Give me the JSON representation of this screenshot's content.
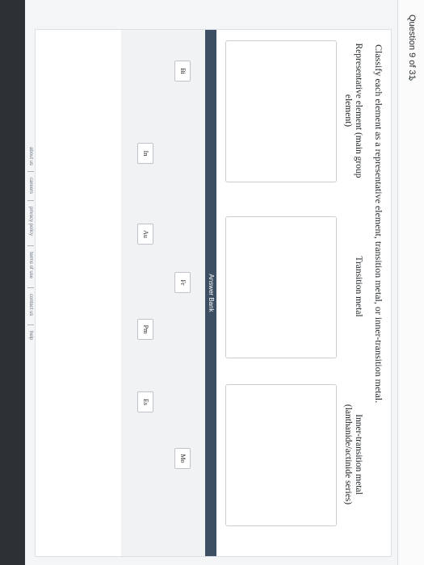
{
  "question": {
    "label": "Question 9 of 31",
    "next_arrow": "›"
  },
  "prompt": "Classify each element as a representative element, transition metal, or inner-transition metal.",
  "categories": [
    "Representative element (main group element)",
    "Transition metal",
    "Inner-transition metal (lanthanide/actinide series)"
  ],
  "answer_bank": {
    "title": "Answer Bank",
    "row1": [
      "Bi",
      "Fr",
      "Mo"
    ],
    "row2": [
      "In",
      "Au",
      "Pm",
      "Es"
    ]
  },
  "footer": [
    "about us",
    "careers",
    "privacy policy",
    "terms of use",
    "contact us",
    "help"
  ],
  "colors": {
    "bank_header": "#3d5063",
    "page_bg": "#f4f5f6",
    "outer_bg": "#7f8891"
  }
}
